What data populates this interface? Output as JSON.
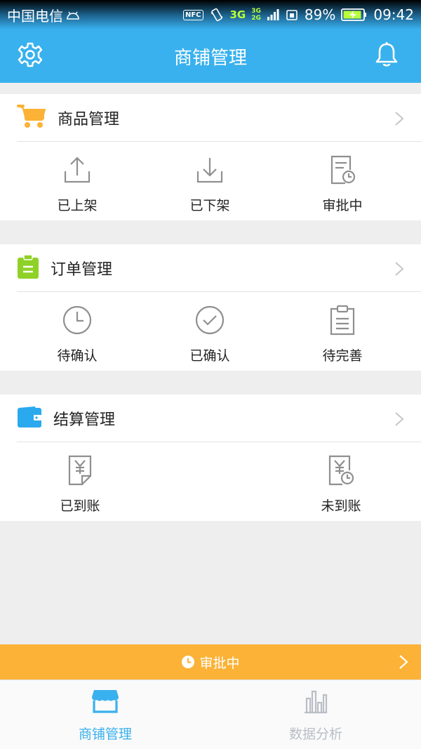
{
  "status_bar": {
    "carrier": "中国电信",
    "nfc": "NFC",
    "network_primary": "3G",
    "network_stack_top": "3G",
    "network_stack_bottom": "2G",
    "battery": "89%",
    "time": "09:42"
  },
  "header": {
    "title": "商铺管理",
    "left_icon": "gear-icon",
    "right_icon": "bell-icon"
  },
  "sections": [
    {
      "title": "商品管理",
      "icon": "shopping-cart-icon",
      "icon_color": "#fbb236",
      "items": [
        {
          "label": "已上架",
          "icon": "upload-icon"
        },
        {
          "label": "已下架",
          "icon": "download-icon"
        },
        {
          "label": "审批中",
          "icon": "document-clock-icon"
        }
      ]
    },
    {
      "title": "订单管理",
      "icon": "clipboard-icon",
      "icon_color": "#8fd126",
      "items": [
        {
          "label": "待确认",
          "icon": "clock-icon"
        },
        {
          "label": "已确认",
          "icon": "check-circle-icon"
        },
        {
          "label": "待完善",
          "icon": "clipboard-list-icon"
        }
      ]
    },
    {
      "title": "结算管理",
      "icon": "wallet-icon",
      "icon_color": "#2aa9ee",
      "items": [
        {
          "label": "已到账",
          "icon": "yen-document-icon"
        },
        {
          "label": "未到账",
          "icon": "yen-clock-icon"
        }
      ]
    }
  ],
  "banner": {
    "text": "审批中",
    "icon": "clock-icon"
  },
  "tab_bar": {
    "tabs": [
      {
        "label": "商铺管理",
        "icon": "store-icon",
        "active": true
      },
      {
        "label": "数据分析",
        "icon": "bar-chart-icon",
        "active": false
      }
    ]
  },
  "colors": {
    "primary": "#39b1ee",
    "banner": "#fbb236",
    "icon_gray": "#8f8f8f",
    "tab_inactive": "#b9bec6"
  }
}
